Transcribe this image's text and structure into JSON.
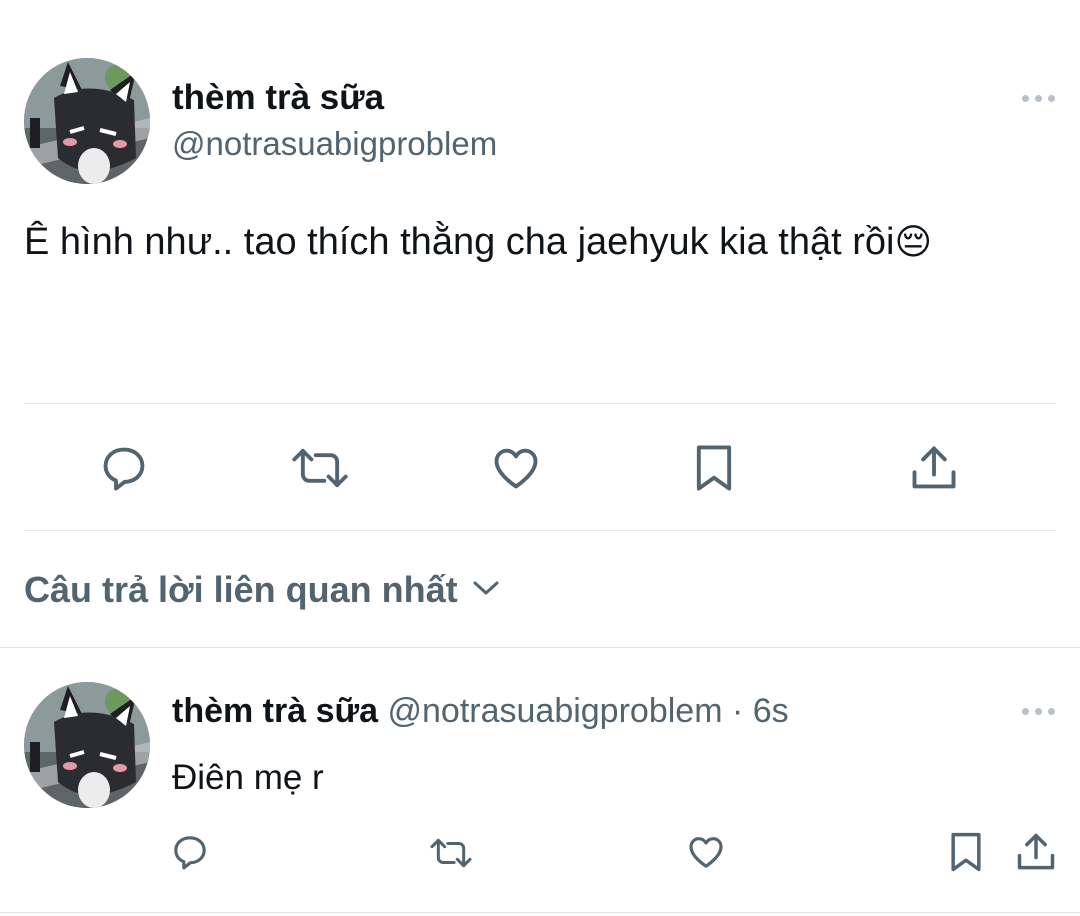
{
  "tweet": {
    "display_name": "thèm trà sữa",
    "handle": "@notrasuabigproblem",
    "text": "Ê hình như.. tao thích thằng cha jaehyuk kia thật rồi",
    "emoji": "😔"
  },
  "replies_sort": {
    "label": "Câu trả lời liên quan nhất"
  },
  "reply": {
    "display_name": "thèm trà sữa",
    "handle": "@notrasuabigproblem",
    "separator": "·",
    "time": "6s",
    "text": "Điên mẹ r"
  },
  "icon_color": "#536471"
}
